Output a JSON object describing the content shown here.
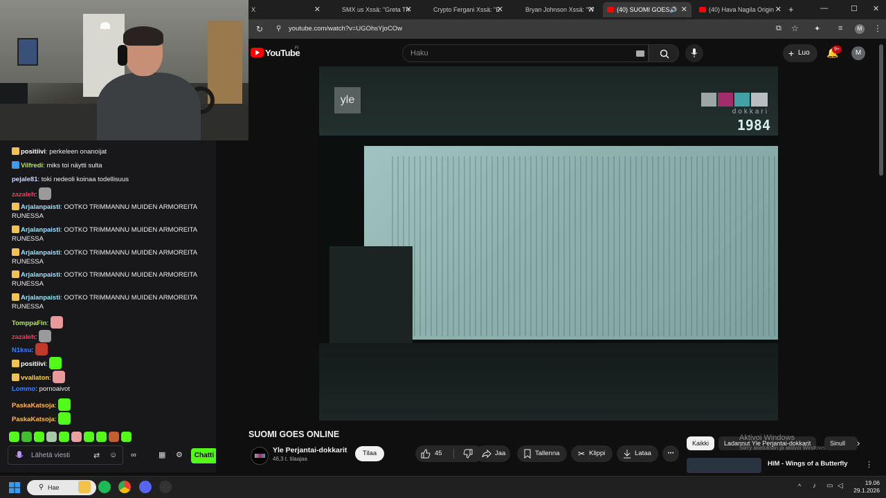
{
  "chat": {
    "messages": [
      {
        "user": "positiivi",
        "text": "perkeleen onanoijat",
        "color": "#ffffff"
      },
      {
        "user": "Vilfredi",
        "text": "miks toi näytti sulta",
        "color": "#b7e64d"
      },
      {
        "user": "pejale81",
        "text": "toki nedeoli koinaa todellisuus",
        "color": "#c9d9ff"
      },
      {
        "user": "zazaleh",
        "text": "",
        "color": "#ff3366"
      },
      {
        "user": "Arjalanpaisti",
        "text": "OOTKO TRIMMANNU MUIDEN ARMOREITA RUNESSA",
        "color": "#93e6ff"
      },
      {
        "user": "Arjalanpaisti",
        "text": "OOTKO TRIMMANNU MUIDEN ARMOREITA RUNESSA",
        "color": "#93e6ff"
      },
      {
        "user": "Arjalanpaisti",
        "text": "OOTKO TRIMMANNU MUIDEN ARMOREITA RUNESSA",
        "color": "#93e6ff"
      },
      {
        "user": "Arjalanpaisti",
        "text": "OOTKO TRIMMANNU MUIDEN ARMOREITA RUNESSA",
        "color": "#93e6ff"
      },
      {
        "user": "Arjalanpaisti",
        "text": "OOTKO TRIMMANNU MUIDEN ARMOREITA RUNESSA",
        "color": "#93e6ff"
      },
      {
        "user": "TomppaFin",
        "text": "",
        "color": "#b7e64d"
      },
      {
        "user": "zazaleh",
        "text": "",
        "color": "#ff3366"
      },
      {
        "user": "N1ksu",
        "text": "",
        "color": "#3f7cff"
      },
      {
        "user": "positiivi",
        "text": "",
        "color": "#ffffff"
      },
      {
        "user": "vvallaton",
        "text": "",
        "color": "#ffd34d"
      },
      {
        "user": "Lommo",
        "text": "pornoaivot",
        "color": "#3f7cff"
      },
      {
        "user": "PaskaKatsoja",
        "text": "",
        "color": "#ffb84d"
      },
      {
        "user": "PaskaKatsoja",
        "text": "",
        "color": "#ffb84d"
      }
    ],
    "input_placeholder": "Lähetä viesti",
    "send_label": "Chatti"
  },
  "browser": {
    "tabs": [
      {
        "title": "X"
      },
      {
        "title": "SMX us Xssä: \"Greta Th"
      },
      {
        "title": "Crypto Fergani Xssä: \"E"
      },
      {
        "title": "Bryan Johnson Xssä: \"W"
      },
      {
        "title": "(40) SUOMI GOES O"
      },
      {
        "title": "(40) Hava Nagila Origin"
      }
    ],
    "url": "youtube.com/watch?v=UGOhsYjoCOw"
  },
  "youtube": {
    "logo_text": "YouTube",
    "logo_region": "FI",
    "search_placeholder": "Haku",
    "create_label": "Luo",
    "notification_count": "9+",
    "avatar_letter": "M",
    "video": {
      "yle_logo": "yle",
      "dokkari_text": "dokkari",
      "year": "1984"
    },
    "title": "SUOMI GOES ONLINE",
    "channel_name": "Yle Perjantai-dokkarit",
    "subscribers": "46,3 t. tilaajaa",
    "subscribe_label": "Tilaa",
    "likes": "45",
    "share_label": "Jaa",
    "save_label": "Tallenna",
    "clip_label": "Klippi",
    "download_label": "Lataa",
    "chips": [
      "Kaikki",
      "Ladannut Yle Perjantai-dokkarit",
      "Sinull"
    ],
    "recommendation_title": "HIM - Wings of a Butterfly",
    "watermark_title": "Aktivoi Windows",
    "watermark_sub": "Siirry asetuksiin ja aktivoi Windows."
  },
  "taskbar": {
    "search_label": "Hae",
    "time": "19.06",
    "date": "29.1.2026"
  },
  "colors": {
    "kick_green": "#53fc18",
    "youtube_red": "#ff0000"
  }
}
